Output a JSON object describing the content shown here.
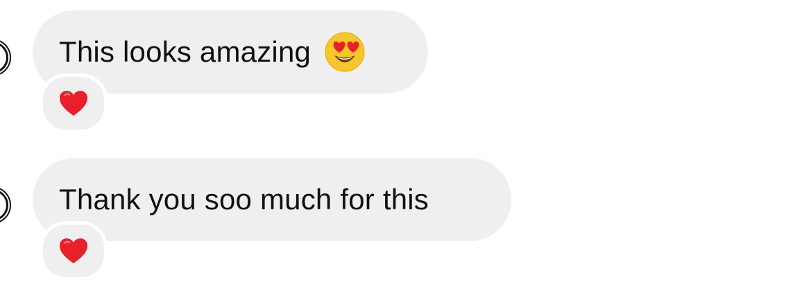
{
  "messages": [
    {
      "text": "This looks amazing",
      "emoji": "heart-eyes-emoji",
      "reaction": "heart"
    },
    {
      "text": "Thank you soo much for this",
      "emoji": null,
      "reaction": "heart"
    }
  ],
  "colors": {
    "bubble_bg": "#efefef",
    "text": "#111111",
    "heart": "#e8202a"
  }
}
